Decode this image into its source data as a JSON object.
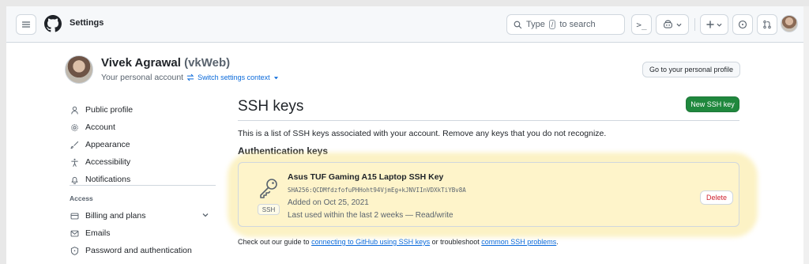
{
  "header": {
    "title": "Settings",
    "search_prefix": "Type",
    "search_key": "/",
    "search_suffix": "to search",
    "command_glyph": ">_"
  },
  "user": {
    "name": "Vivek Agrawal",
    "handle": "(vkWeb)",
    "subtitle": "Your personal account",
    "switch_label": "Switch settings context",
    "profile_button": "Go to your personal profile"
  },
  "sidebar": {
    "items": [
      {
        "label": "Public profile",
        "icon": "person-icon"
      },
      {
        "label": "Account",
        "icon": "gear-icon"
      },
      {
        "label": "Appearance",
        "icon": "paintbrush-icon"
      },
      {
        "label": "Accessibility",
        "icon": "accessibility-icon"
      },
      {
        "label": "Notifications",
        "icon": "bell-icon"
      }
    ],
    "access_heading": "Access",
    "access_items": [
      {
        "label": "Billing and plans",
        "icon": "credit-card-icon"
      },
      {
        "label": "Emails",
        "icon": "mail-icon"
      },
      {
        "label": "Password and authentication",
        "icon": "shield-lock-icon"
      }
    ]
  },
  "main": {
    "title": "SSH keys",
    "new_key_button": "New SSH key",
    "description": "This is a list of SSH keys associated with your account. Remove any keys that you do not recognize.",
    "section_heading": "Authentication keys",
    "key": {
      "title": "Asus TUF Gaming A15 Laptop SSH Key",
      "fingerprint": "SHA256:QCDMfdzfofuPHHoht94VjmEg+kJNVIInVDXkTiYBv8A",
      "added": "Added on Oct 25, 2021",
      "last_used": "Last used within the last 2 weeks — Read/write",
      "type_label": "SSH",
      "delete_button": "Delete"
    },
    "footer": {
      "prefix": "Check out our guide to",
      "link1": "connecting to GitHub using SSH keys",
      "middle": "or troubleshoot",
      "link2": "common SSH problems",
      "suffix": "."
    }
  },
  "colors": {
    "primary_button": "#1f883d",
    "link": "#0969da",
    "danger": "#cf222e",
    "highlight": "#fae896"
  }
}
